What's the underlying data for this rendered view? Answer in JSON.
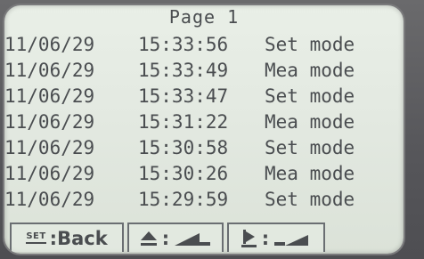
{
  "page": {
    "title": "Page 1"
  },
  "log": [
    {
      "date": "11/06/29",
      "time": "15:33:56",
      "mode": "Set mode"
    },
    {
      "date": "11/06/29",
      "time": "15:33:49",
      "mode": "Mea mode"
    },
    {
      "date": "11/06/29",
      "time": "15:33:47",
      "mode": "Set mode"
    },
    {
      "date": "11/06/29",
      "time": "15:31:22",
      "mode": "Mea mode"
    },
    {
      "date": "11/06/29",
      "time": "15:30:58",
      "mode": "Set mode"
    },
    {
      "date": "11/06/29",
      "time": "15:30:26",
      "mode": "Mea mode"
    },
    {
      "date": "11/06/29",
      "time": "15:29:59",
      "mode": "Set mode"
    }
  ],
  "softkeys": {
    "back": {
      "icon": "set-key-icon",
      "icon_text": "SET",
      "label": ":Back"
    },
    "up": {
      "icon": "eject-up-icon",
      "separator": ":",
      "action_icon": "ramp-up-icon"
    },
    "next": {
      "icon": "play-step-icon",
      "separator": ":",
      "action_icon": "ramp-right-icon"
    }
  },
  "colors": {
    "screen_bg": "#e3e9e1",
    "text": "#4a4d50",
    "bezel": "#5d5d5f"
  }
}
